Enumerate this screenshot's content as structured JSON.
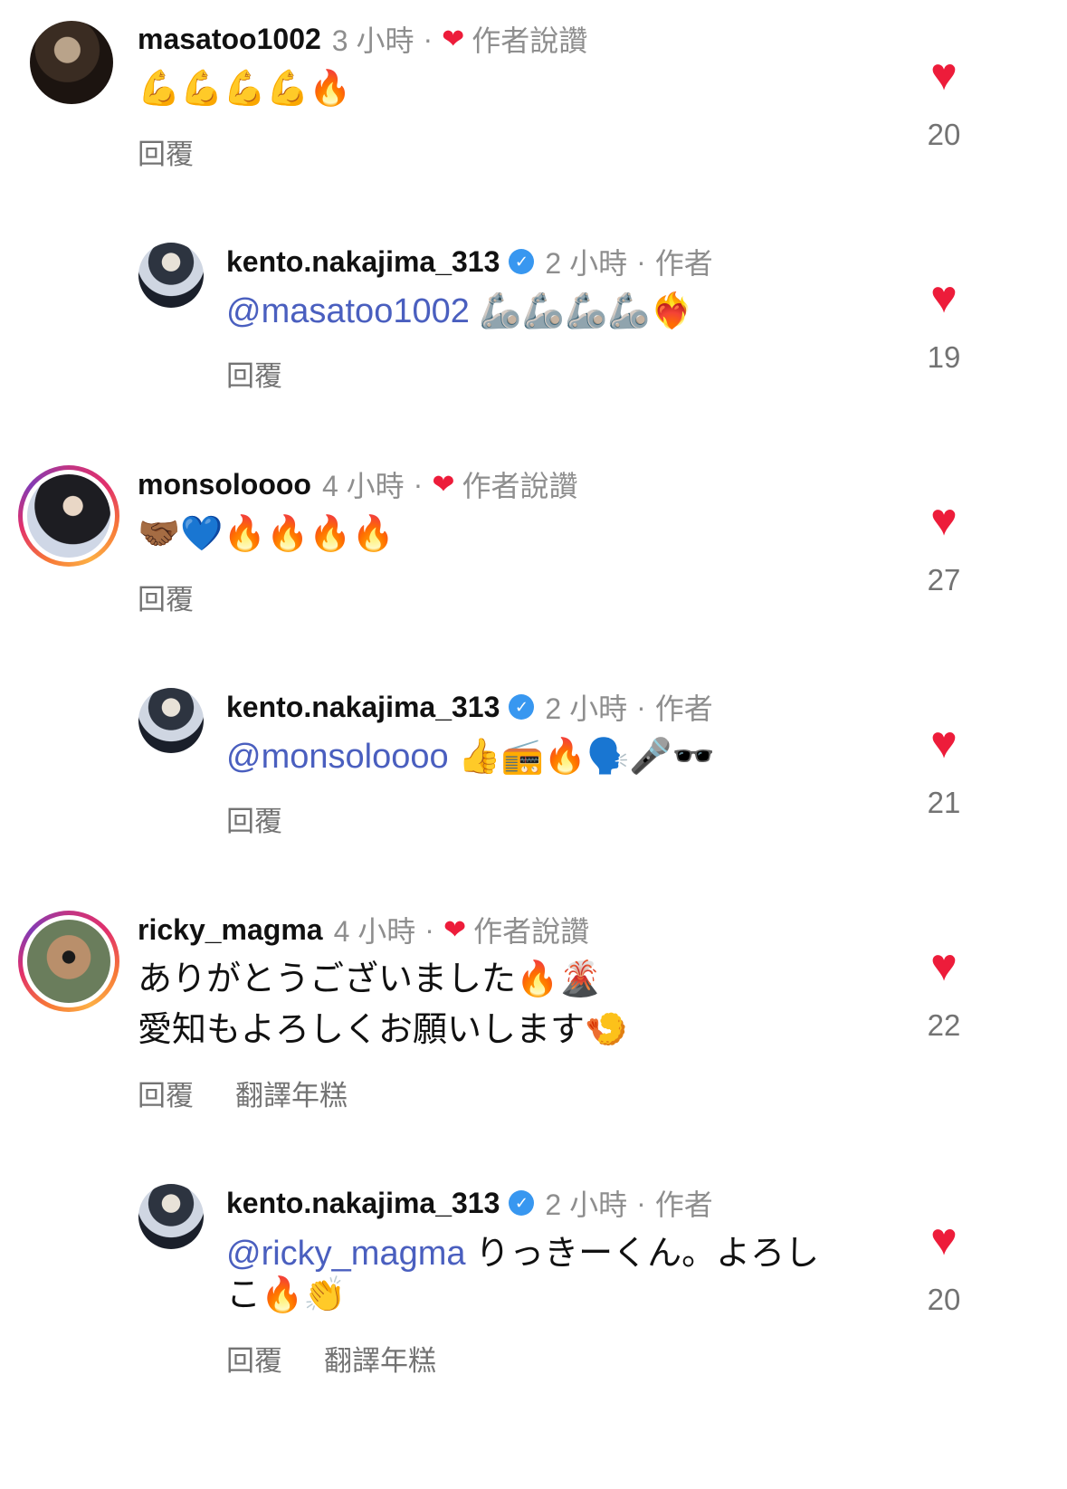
{
  "comments": [
    {
      "username": "masatoo1002",
      "time": "3 小時",
      "separator": "·",
      "liked_label": "作者說讚",
      "text": "💪💪💪💪🔥",
      "reply_label": "回覆",
      "likes": "20"
    },
    {
      "username": "kento.nakajima_313",
      "time": "2 小時",
      "separator": "·",
      "author_label": "作者",
      "mention": "@masatoo1002",
      "text": " 🦾🦾🦾🦾❤️‍🔥",
      "reply_label": "回覆",
      "likes": "19"
    },
    {
      "username": "monsoloooo",
      "time": "4 小時",
      "separator": "·",
      "liked_label": "作者說讚",
      "text": "🤝🏾💙🔥🔥🔥🔥",
      "reply_label": "回覆",
      "likes": "27"
    },
    {
      "username": "kento.nakajima_313",
      "time": "2 小時",
      "separator": "·",
      "author_label": "作者",
      "mention": "@monsoloooo",
      "text": " 👍📻🔥🗣️🎤🕶️",
      "reply_label": "回覆",
      "likes": "21"
    },
    {
      "username": "ricky_magma",
      "time": "4 小時",
      "separator": "·",
      "liked_label": "作者說讚",
      "text_line1": "ありがとうございました🔥🌋",
      "text_line2": "愛知もよろしくお願いします🍤",
      "reply_label": "回覆",
      "translate_label": "翻譯年糕",
      "likes": "22"
    },
    {
      "username": "kento.nakajima_313",
      "time": "2 小時",
      "separator": "·",
      "author_label": "作者",
      "mention": "@ricky_magma",
      "text_line1": " りっきーくん。よろし",
      "text_line2": "こ🔥👏",
      "reply_label": "回覆",
      "translate_label": "翻譯年糕",
      "likes": "20"
    }
  ],
  "icons": {
    "heart": "heart-icon",
    "verified": "verified-badge-icon",
    "like_color": "#ed1c3a",
    "mention_color": "#4a5fbf"
  }
}
